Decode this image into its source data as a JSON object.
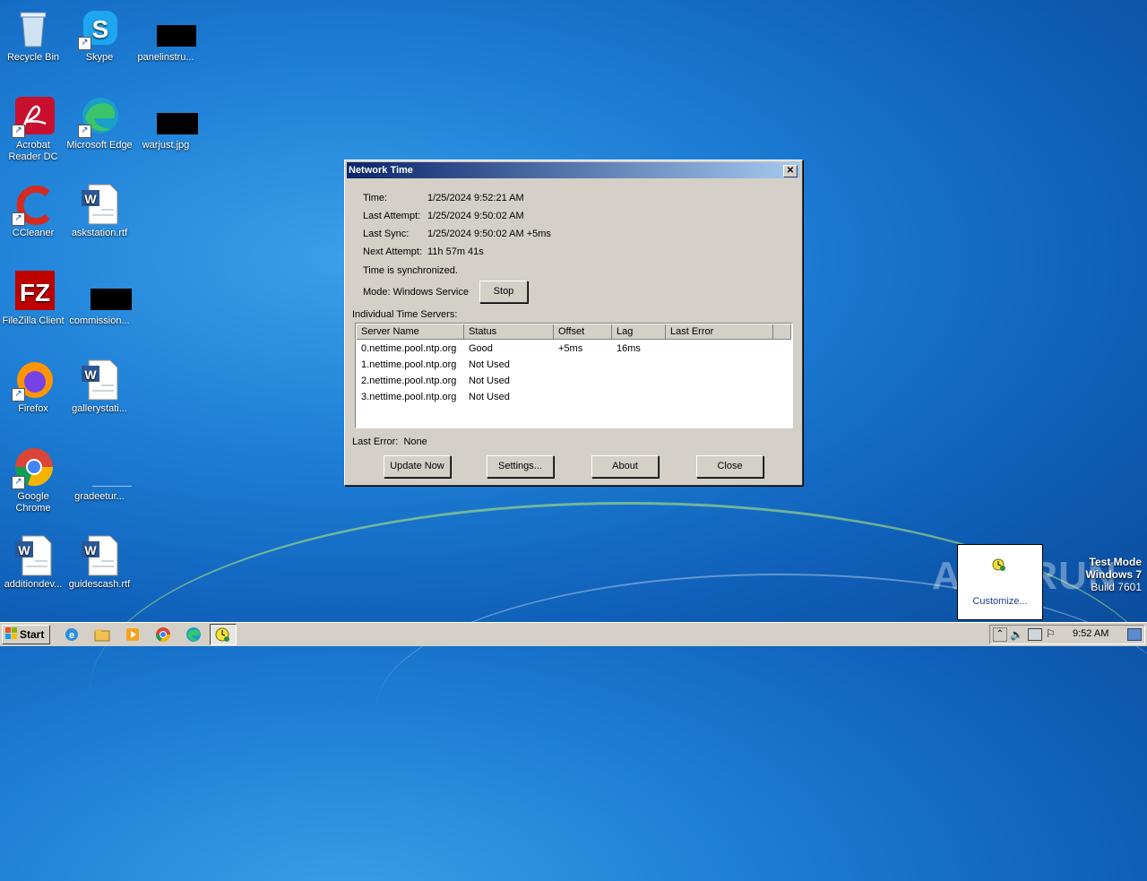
{
  "desktop": {
    "icons": [
      {
        "label": "Recycle Bin"
      },
      {
        "label": "Skype"
      },
      {
        "label": "panelinstru..."
      },
      {
        "label": "Acrobat Reader DC"
      },
      {
        "label": "Microsoft Edge"
      },
      {
        "label": "warjust.jpg"
      },
      {
        "label": "CCleaner"
      },
      {
        "label": "askstation.rtf"
      },
      {
        "label": "FileZilla Client"
      },
      {
        "label": "commission..."
      },
      {
        "label": "Firefox"
      },
      {
        "label": "gallerystati..."
      },
      {
        "label": "Google Chrome"
      },
      {
        "label": "gradeetur..."
      },
      {
        "label": "additiondev..."
      },
      {
        "label": "guidescash.rtf"
      }
    ]
  },
  "dialog": {
    "title": "Network Time",
    "close_glyph": "✕",
    "time_label": "Time:",
    "time_value": "1/25/2024 9:52:21 AM",
    "last_attempt_label": "Last Attempt:",
    "last_attempt_value": "1/25/2024 9:50:02 AM",
    "last_sync_label": "Last Sync:",
    "last_sync_value": "1/25/2024 9:50:02 AM +5ms",
    "next_attempt_label": "Next Attempt:",
    "next_attempt_value": "11h 57m 41s",
    "status_text": "Time is synchronized.",
    "mode_text": "Mode: Windows Service",
    "stop_label": "Stop",
    "servers_heading": "Individual Time Servers:",
    "columns": [
      "Server Name",
      "Status",
      "Offset",
      "Lag",
      "Last Error"
    ],
    "rows": [
      {
        "server": "0.nettime.pool.ntp.org",
        "status": "Good",
        "offset": "+5ms",
        "lag": "16ms",
        "error": ""
      },
      {
        "server": "1.nettime.pool.ntp.org",
        "status": "Not Used",
        "offset": "",
        "lag": "",
        "error": ""
      },
      {
        "server": "2.nettime.pool.ntp.org",
        "status": "Not Used",
        "offset": "",
        "lag": "",
        "error": ""
      },
      {
        "server": "3.nettime.pool.ntp.org",
        "status": "Not Used",
        "offset": "",
        "lag": "",
        "error": ""
      }
    ],
    "last_error_text": "Last Error:  None",
    "buttons": {
      "update": "Update Now",
      "settings": "Settings...",
      "about": "About",
      "close": "Close"
    }
  },
  "popup": {
    "customize": "Customize..."
  },
  "watermark": {
    "line1": "Test Mode",
    "line2": "Windows 7",
    "line3": "Build 7601",
    "brand": "ANY RUN"
  },
  "taskbar": {
    "start": "Start",
    "clock": "9:52 AM"
  }
}
